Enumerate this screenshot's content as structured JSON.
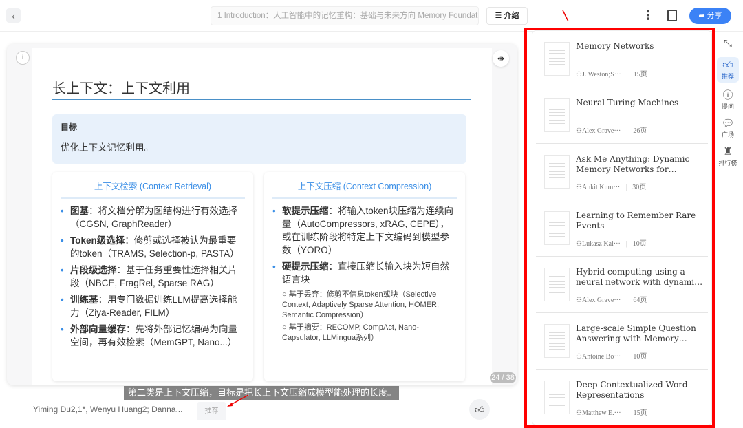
{
  "header": {
    "back": "‹",
    "doc_title": "1 Introduction：人工智能中的记忆重构：基础与未来方向  Memory Foundations",
    "intro": "介绍",
    "share": "分享"
  },
  "slide": {
    "title": "长上下文：上下文利用",
    "goal_label": "目标",
    "goal_text": "优化上下文记忆利用。",
    "left": {
      "heading": "上下文检索 (Context Retrieval)",
      "items": [
        {
          "b": "图基",
          "t": "：将文档分解为图结构进行有效选择（CGSN, GraphReader）"
        },
        {
          "b": "Token级选择",
          "t": "：修剪或选择被认为最重要的token（TRAMS, Selection-p, PASTA）"
        },
        {
          "b": "片段级选择",
          "t": "：基于任务重要性选择相关片段（NBCE, FragRel, Sparse RAG）"
        },
        {
          "b": "训练基",
          "t": "：用专门数据训练LLM提高选择能力（Ziya-Reader, FILM）"
        },
        {
          "b": "外部向量缓存",
          "t": "：先将外部记忆编码为向量空间，再有效检索（MemGPT, Nano...）"
        }
      ]
    },
    "right": {
      "heading": "上下文压缩 (Context Compression)",
      "items": [
        {
          "b": "软提示压缩",
          "t": "：将输入token块压缩为连续向量（AutoCompressors, xRAG, CEPE），或在训练阶段将特定上下文编码到模型参数（YORO）"
        },
        {
          "b": "硬提示压缩",
          "t": "：直接压缩长输入块为短自然语言块"
        }
      ],
      "subs": [
        "○ 基于丢弃：修剪不信息token或块（Selective Context, Adaptively Sparse Attention, HOMER, Semantic Compression）",
        "○ 基于摘要：RECOMP, CompAct, Nano-Capsulator, LLMingua系列）"
      ]
    },
    "caption": "第二类是上下文压缩，目标是把长上下文压缩成模型能处理的长度。",
    "page": "24 / 38"
  },
  "footer": {
    "authors": "Yiming Du2,1*, Wenyu Huang2; Danna...",
    "recommend": "推荐"
  },
  "recommendations": [
    {
      "title": "Memory Networks",
      "author": "J. Weston;S···",
      "pages": "15页"
    },
    {
      "title": "Neural Turing Machines",
      "author": "Alex Grave···",
      "pages": "26页"
    },
    {
      "title": "Ask Me Anything: Dynamic Memory Networks for Natural Language Processing",
      "author": "Ankit Kum···",
      "pages": "30页"
    },
    {
      "title": "Learning to Remember Rare Events",
      "author": "Lukasz Kai···",
      "pages": "10页"
    },
    {
      "title": "Hybrid computing using a neural network with dynamic external memory",
      "author": "Alex Grave···",
      "pages": "64页"
    },
    {
      "title": "Large-scale Simple Question Answering with Memory Networks",
      "author": "Antoine Bo···",
      "pages": "10页"
    },
    {
      "title": "Deep Contextualized Word Representations",
      "author": "Matthew E.···",
      "pages": "15页"
    }
  ],
  "rail": [
    {
      "icon": "collapse-icon",
      "label": ""
    },
    {
      "icon": "thumbs-up-star-icon",
      "label": "推荐"
    },
    {
      "icon": "question-icon",
      "label": "提问"
    },
    {
      "icon": "chat-icon",
      "label": "广场"
    },
    {
      "icon": "ranking-icon",
      "label": "排行榜"
    }
  ],
  "colors": {
    "accent": "#3b82f6",
    "highlight": "#ff0000"
  }
}
